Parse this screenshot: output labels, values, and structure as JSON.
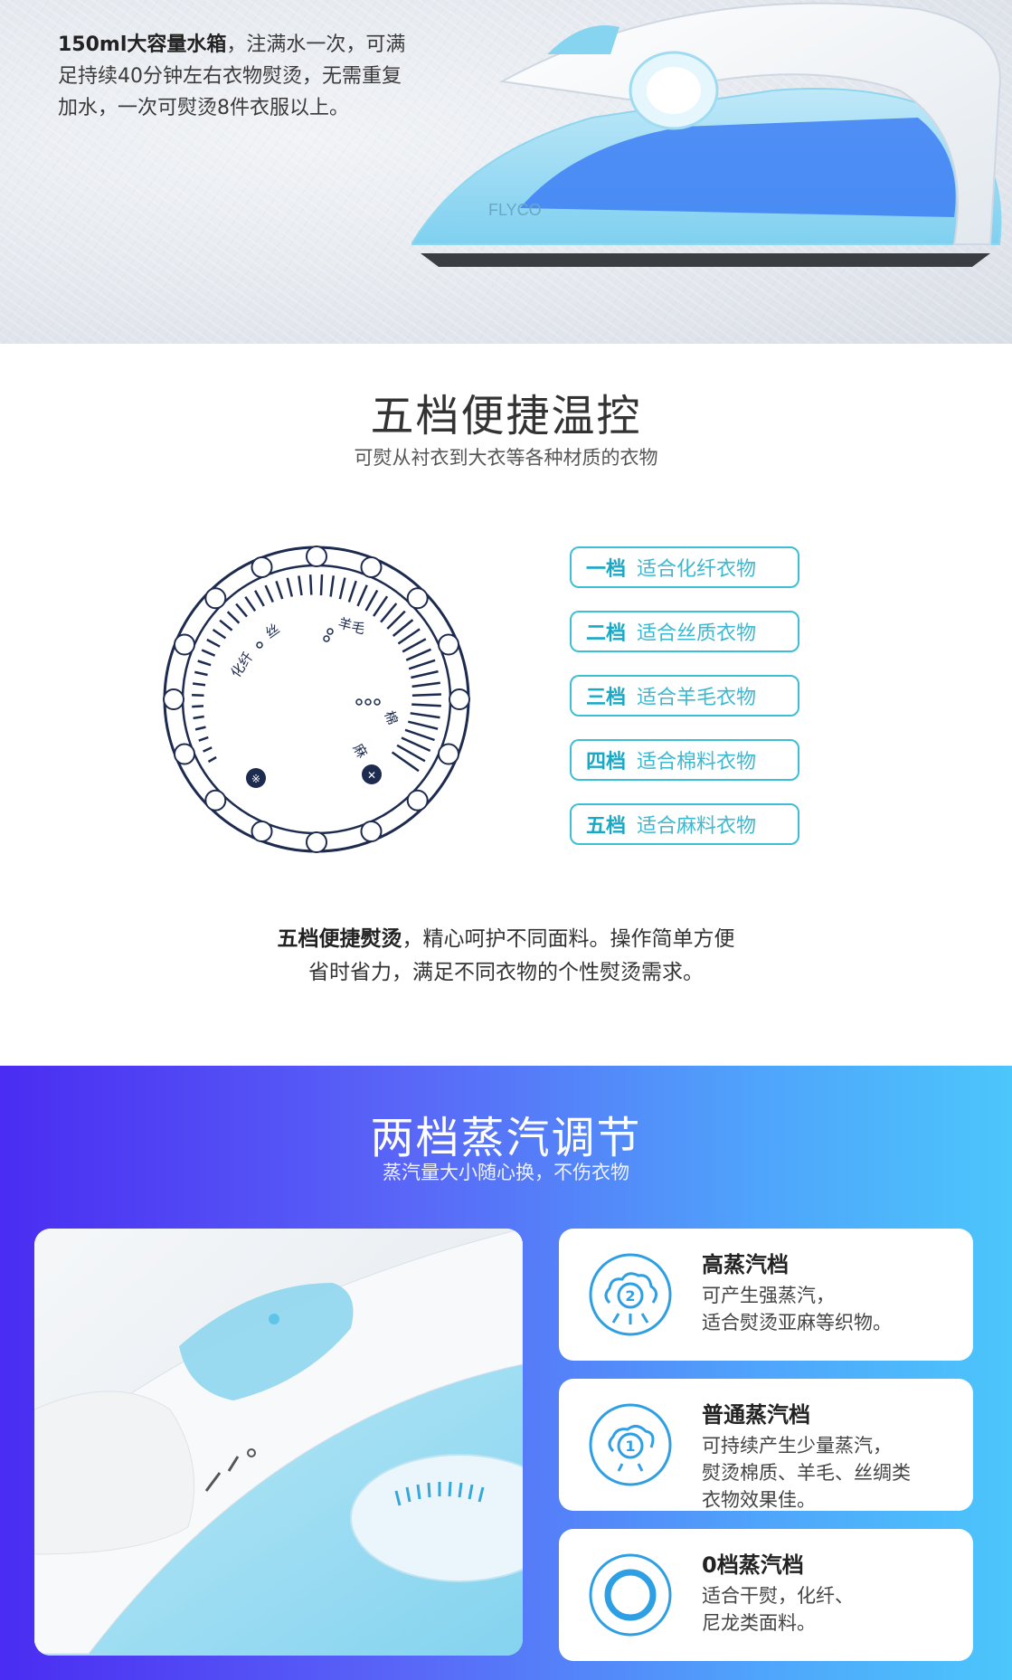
{
  "water_tank": {
    "bold": "150ml大容量水箱",
    "rest": "，注满水一次，可满足持续40分钟左右衣物熨烫，无需重复加水，一次可熨烫8件衣服以上。",
    "brand": "FLYCO"
  },
  "temperature": {
    "title": "五档便捷温控",
    "subtitle": "可熨从衬衣到大衣等各种材质的衣物",
    "dial_labels": {
      "synthetic": "化纤",
      "silk": "丝",
      "wool": "羊毛",
      "cotton": "棉",
      "linen": "麻"
    },
    "levels": [
      {
        "level": "一档",
        "text": "适合化纤衣物"
      },
      {
        "level": "二档",
        "text": "适合丝质衣物"
      },
      {
        "level": "三档",
        "text": "适合羊毛衣物"
      },
      {
        "level": "四档",
        "text": "适合棉料衣物"
      },
      {
        "level": "五档",
        "text": "适合麻料衣物"
      }
    ],
    "desc_bold": "五档便捷熨烫",
    "desc_line1": "，精心呵护不同面料。操作简单方便",
    "desc_line2": "省时省力，满足不同衣物的个性熨烫需求。"
  },
  "steam": {
    "title": "两档蒸汽调节",
    "subtitle": "蒸汽量大小随心换，不伤衣物",
    "modes": [
      {
        "title": "高蒸汽档",
        "lines": [
          "可产生强蒸汽，",
          "适合熨烫亚麻等织物。"
        ],
        "icon_number": "2"
      },
      {
        "title": "普通蒸汽档",
        "lines": [
          "可持续产生少量蒸汽，",
          "熨烫棉质、羊毛、丝绸类",
          "衣物效果佳。"
        ],
        "icon_number": "1"
      },
      {
        "title": "0档蒸汽档",
        "lines": [
          "适合干熨，化纤、",
          "尼龙类面料。"
        ]
      }
    ]
  },
  "colors": {
    "accent_teal": "#3cbfd6",
    "dial_navy": "#1d2b4f",
    "steam_icon_blue": "#2f9fe4",
    "gradient_start": "#4a2cf2",
    "gradient_end": "#4cc6fb"
  }
}
